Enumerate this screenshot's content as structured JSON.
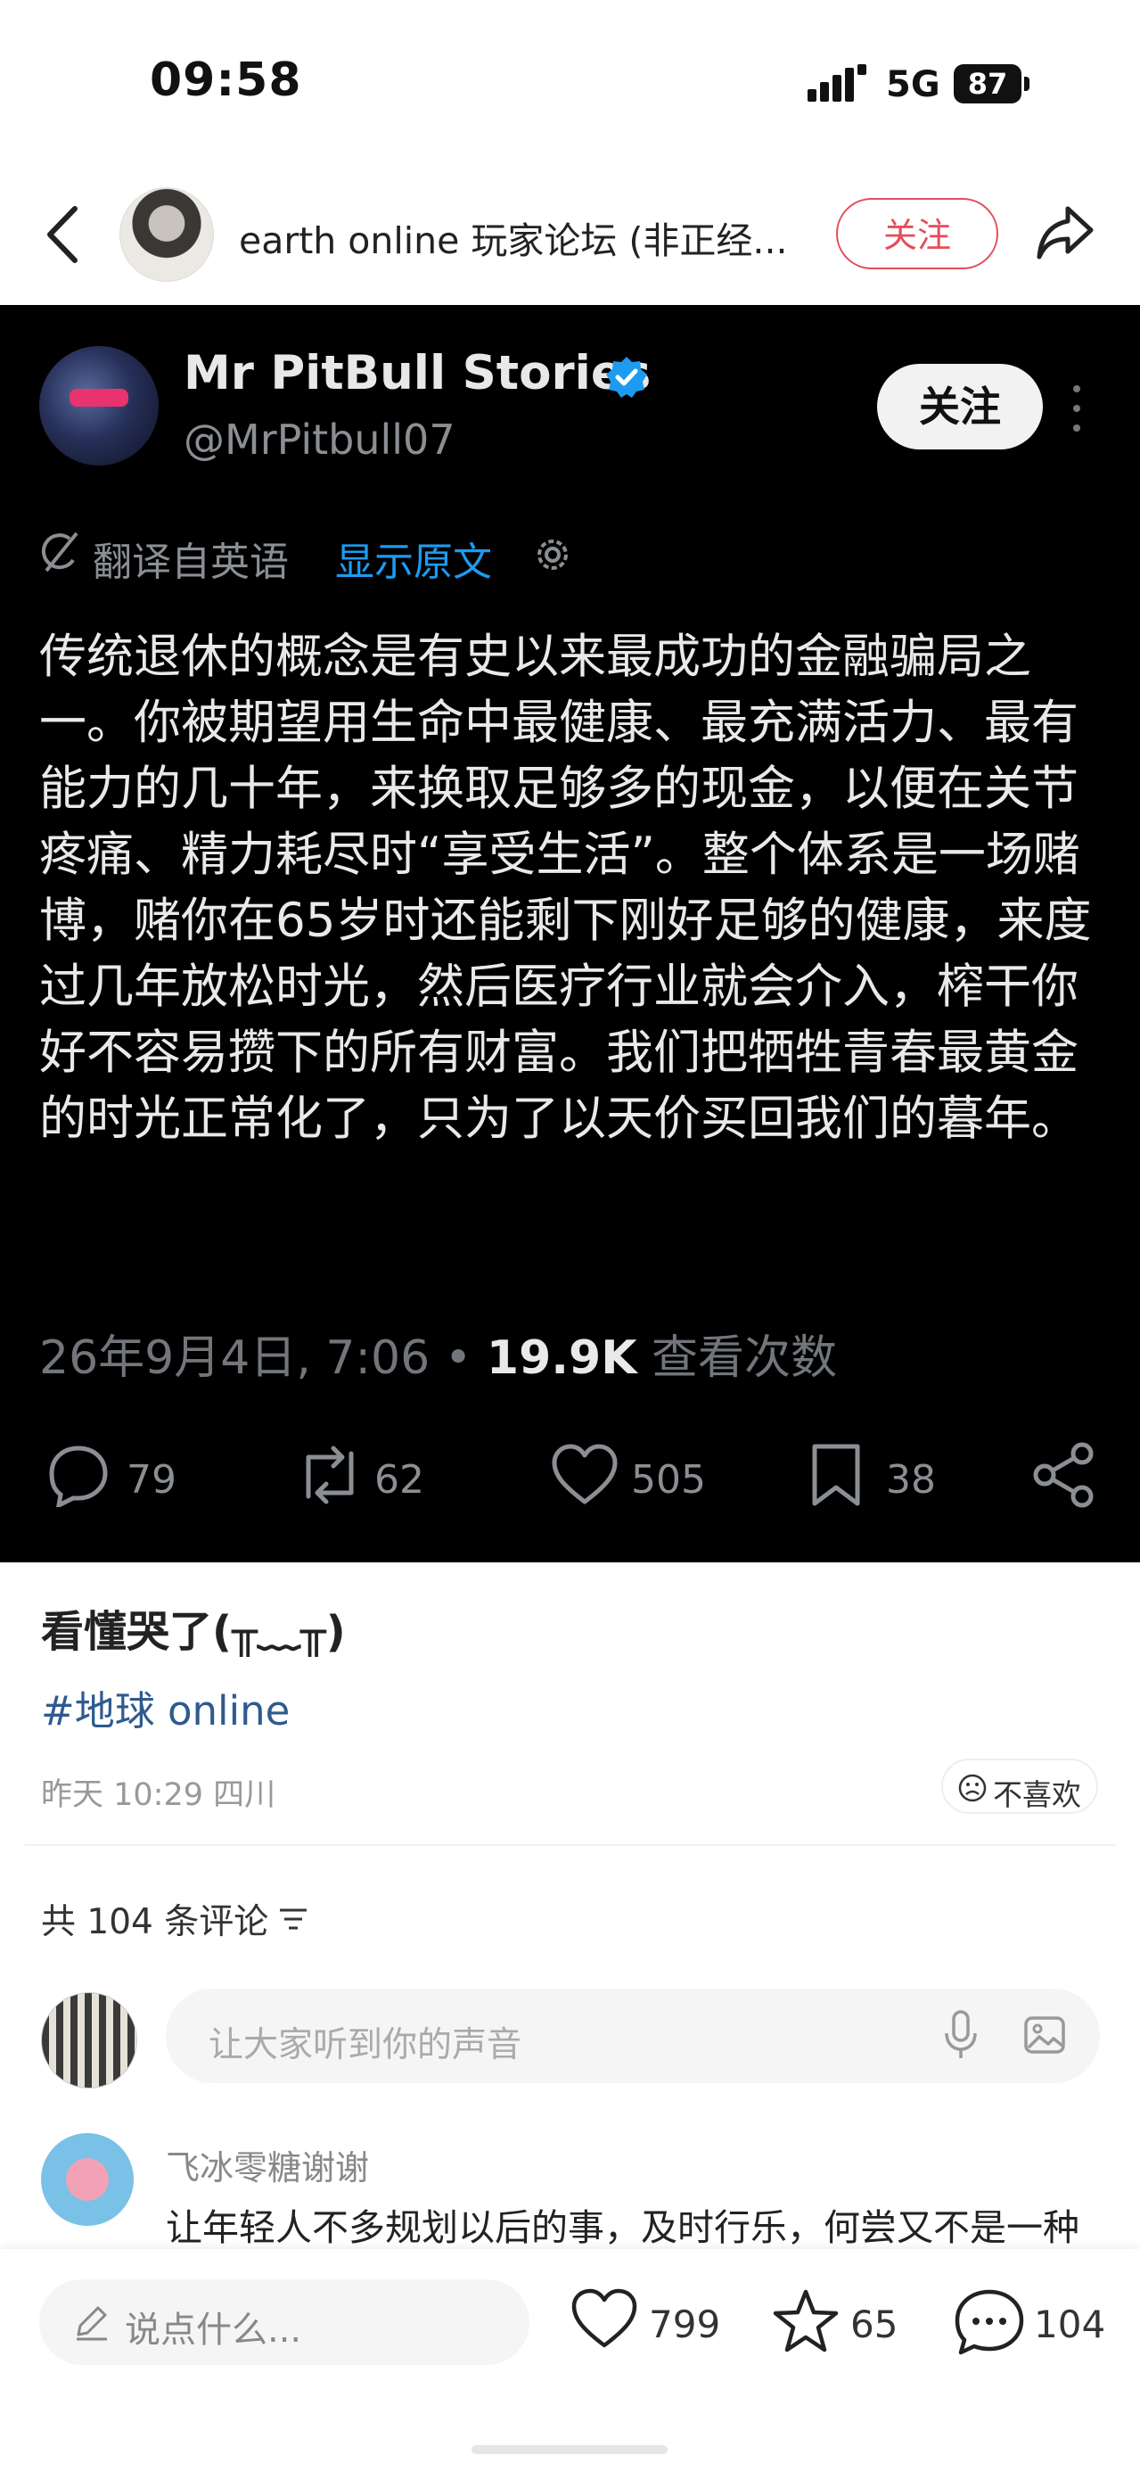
{
  "status_bar": {
    "time": "09:58",
    "network": "5G",
    "battery": "87"
  },
  "header": {
    "title": "earth online 玩家论坛 (非正经...",
    "follow_label": "关注"
  },
  "embedded_post": {
    "author_name": "Mr PitBull Stories",
    "handle": "@MrPitbull07",
    "follow_label": "关注",
    "translated_label": "翻译自英语",
    "show_original_label": "显示原文",
    "body": "传统退休的概念是有史以来最成功的金融骗局之一。你被期望用生命中最健康、最充满活力、最有能力的几十年，来换取足够多的现金，以便在关节疼痛、精力耗尽时“享受生活”。整个体系是一场赌博，赌你在65岁时还能剩下刚好足够的健康，来度过几年放松时光，然后医疗行业就会介入，榨干你好不容易攒下的所有财富。我们把牺牲青春最黄金的时光正常化了，只为了以天价买回我们的暮年。",
    "date": "26年9月4日, 7:06 • ",
    "views": "19.9K",
    "views_label": " 查看次数",
    "stats": {
      "replies": "79",
      "reposts": "62",
      "likes": "505",
      "bookmarks": "38"
    }
  },
  "note": {
    "title": "看懂哭了(╥﹏╥)",
    "hashtag": "#地球 online",
    "meta": "昨天 10:29 四川",
    "dislike_label": "不喜欢"
  },
  "comments": {
    "count_label": "共 104 条评论",
    "input_placeholder": "让大家听到你的声音",
    "items": [
      {
        "user": "飞冰零糖谢谢",
        "text": "让年轻人不多规划以后的事，及时行乐，何尝又不是一种"
      }
    ]
  },
  "bottom_bar": {
    "say_placeholder": "说点什么...",
    "likes": "799",
    "favorites": "65",
    "comments": "104"
  },
  "colors": {
    "accent": "#e54d5a",
    "twitter_blue": "#1d9bf0",
    "hashtag": "#2f5a8e"
  }
}
